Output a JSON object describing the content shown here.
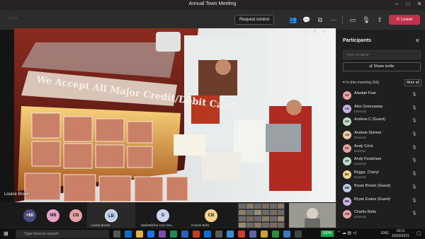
{
  "window": {
    "title": "Annual Town Meeting"
  },
  "toolbar": {
    "timer": "-:-:-",
    "request_control_label": "Request control",
    "leave_label": "Leave",
    "accent": "#c4314b"
  },
  "video": {
    "speaker_name": "Louise Brown",
    "sign_text": "We Accept All Major Credit/Debit Cards"
  },
  "participants": {
    "title": "Participants",
    "search_placeholder": "Type a name",
    "share_invite_label": "Share invite",
    "section_label": "In this meeting (66)",
    "mute_all_label": "Mute all",
    "items": [
      {
        "initials": "AF",
        "name": "Alastair Fear",
        "sub": "",
        "color": "#e8a2a2"
      },
      {
        "initials": "AG",
        "name": "Alex Greenaway",
        "sub": "External",
        "color": "#c9b4e8"
      },
      {
        "initials": "AC",
        "name": "Andrew C (Guest)",
        "sub": "",
        "color": "#b7dcc7"
      },
      {
        "initials": "AS",
        "name": "Andrew Skinner",
        "sub": "External",
        "color": "#f0c9a6"
      },
      {
        "initials": "AC",
        "name": "Andy Crick",
        "sub": "External",
        "color": "#e8a2a2"
      },
      {
        "initials": "AF",
        "name": "Andy Foulsham",
        "sub": "External",
        "color": "#b7dcc7"
      },
      {
        "initials": "BC",
        "name": "Briggs, Cheryl",
        "sub": "External",
        "color": "#f5d58c"
      },
      {
        "initials": "BB",
        "name": "Bryan Brown (Guest)",
        "sub": "",
        "color": "#b9cdea"
      },
      {
        "initials": "BE",
        "name": "Bryan Evans (Guest)",
        "sub": "",
        "color": "#c9b4e8"
      },
      {
        "initials": "CB",
        "name": "Charlie Birks",
        "sub": "External",
        "color": "#e8a2a2"
      }
    ]
  },
  "strip": {
    "overflow_count": "+60",
    "tiles": [
      {
        "initials": "MB",
        "label": "",
        "color": "#e8a2c9"
      },
      {
        "initials": "CB",
        "label": "",
        "color": "#e8a2a2"
      },
      {
        "initials": "LB",
        "label": "Louise Brown",
        "color": "#b9cdea"
      },
      {
        "initials": "D",
        "label": "dipilott@live.com (Ge...",
        "color": "#c9d6ee"
      },
      {
        "initials": "CB",
        "label": "Charlie Birks",
        "color": "#f5d58c"
      }
    ]
  },
  "taskbar": {
    "search_placeholder": "Type here to search",
    "battery_label": "100%",
    "language": "ENG",
    "time": "19:11",
    "date": "10/03/2021"
  }
}
